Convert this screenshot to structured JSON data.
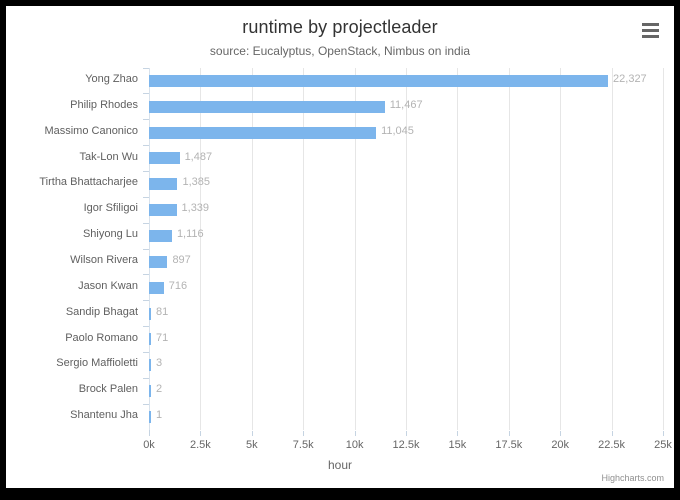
{
  "chart": {
    "title": "runtime by projectleader",
    "subtitle": "source: Eucalyptus, OpenStack, Nimbus on india",
    "credits": "Highcharts.com",
    "menu_icon": "hamburger-icon",
    "bar_color": "#7cb5ec",
    "background_color": "#ffffff",
    "border_color": "#000000"
  },
  "chart_data": {
    "type": "bar",
    "title": "runtime by projectleader",
    "subtitle": "source: Eucalyptus, OpenStack, Nimbus on india",
    "xlabel": "hour",
    "ylabel": "",
    "orientation": "horizontal",
    "grid": true,
    "legend": false,
    "xlim": [
      0,
      25000
    ],
    "xticks": [
      0,
      2500,
      5000,
      7500,
      10000,
      12500,
      15000,
      17500,
      20000,
      22500,
      25000
    ],
    "xtick_labels": [
      "0k",
      "2.5k",
      "5k",
      "7.5k",
      "10k",
      "12.5k",
      "15k",
      "17.5k",
      "20k",
      "22.5k",
      "25k"
    ],
    "categories": [
      "Yong Zhao",
      "Philip Rhodes",
      "Massimo Canonico",
      "Tak-Lon Wu",
      "Tirtha Bhattacharjee",
      "Igor Sfiligoi",
      "Shiyong Lu",
      "Wilson Rivera",
      "Jason Kwan",
      "Sandip Bhagat",
      "Paolo Romano",
      "Sergio Maffioletti",
      "Brock Palen",
      "Shantenu Jha"
    ],
    "values": [
      22327,
      11467,
      11045,
      1487,
      1385,
      1339,
      1116,
      897,
      716,
      81,
      71,
      3,
      2,
      1
    ],
    "value_labels": [
      "22,327",
      "11,467",
      "11,045",
      "1,487",
      "1,385",
      "1,339",
      "1,116",
      "897",
      "716",
      "81",
      "71",
      "3",
      "2",
      "1"
    ],
    "series": [
      {
        "name": "hour",
        "color": "#7cb5ec",
        "values": [
          22327,
          11467,
          11045,
          1487,
          1385,
          1339,
          1116,
          897,
          716,
          81,
          71,
          3,
          2,
          1
        ]
      }
    ]
  }
}
